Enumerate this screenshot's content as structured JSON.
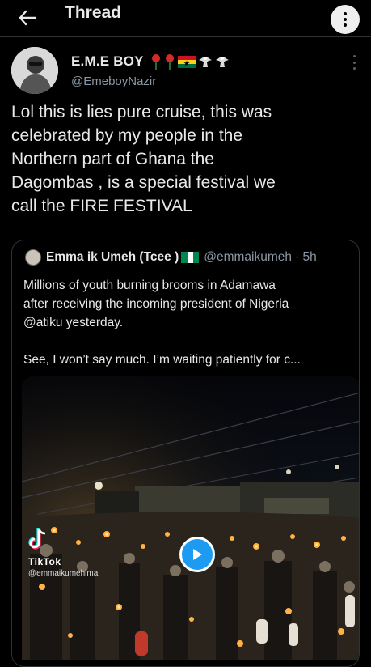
{
  "topbar": {
    "title": "Thread"
  },
  "tweet": {
    "name": "E.M.E BOY",
    "emojis": [
      "rose-emoji",
      "rose-emoji",
      "ghana-flag-emoji",
      "eagle-emoji",
      "eagle-emoji"
    ],
    "handle": "@EmeboyNazir",
    "text": "Lol this is lies pure cruise, this was\ncelebrated by my people in the\nNorthern part of Ghana the\nDagombas , is a special festival we\ncall the FIRE FESTIVAL"
  },
  "quote": {
    "name": "Emma ik Umeh (Tcee )",
    "handle": "@emmaikumeh",
    "time": "· 5h",
    "text": "Millions of youth burning brooms in Adamawa\nafter receiving the incoming president of Nigeria\n@atiku yesterday.\n\nSee, I won’t say much. I’m waiting patiently for c..."
  },
  "media": {
    "watermark": "TikTok",
    "watermark_user": "@emmaikumehima"
  },
  "colors": {
    "background": "#000000",
    "text": "#e7e9ea",
    "secondary": "#8b98a5",
    "border": "#2f3336",
    "accent": "#1d9bf0",
    "nigeria_green": "#008751"
  }
}
